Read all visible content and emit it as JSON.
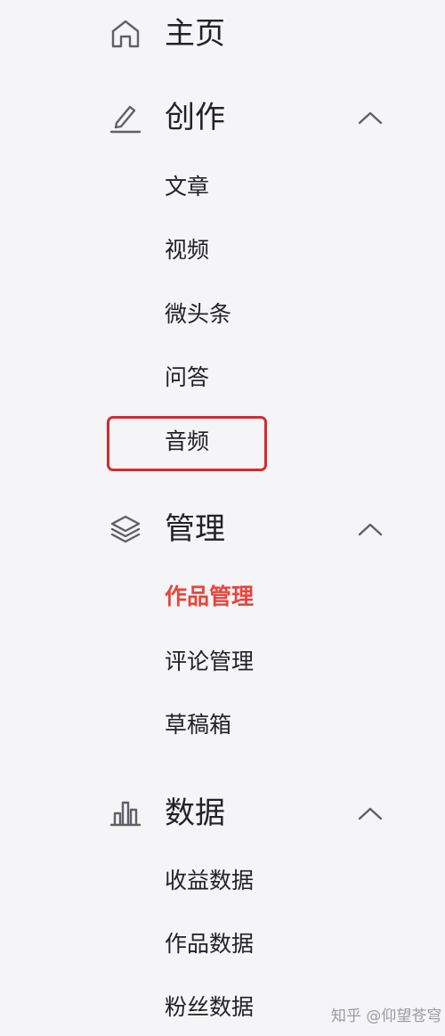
{
  "nav": {
    "home": {
      "label": "主页",
      "icon": "home-icon"
    },
    "create": {
      "label": "创作",
      "icon": "pen-icon",
      "expanded": true,
      "items": [
        {
          "label": "文章"
        },
        {
          "label": "视频"
        },
        {
          "label": "微头条"
        },
        {
          "label": "问答"
        },
        {
          "label": "音频",
          "highlighted": true
        }
      ]
    },
    "manage": {
      "label": "管理",
      "icon": "layers-icon",
      "expanded": true,
      "items": [
        {
          "label": "作品管理",
          "active": true
        },
        {
          "label": "评论管理"
        },
        {
          "label": "草稿箱"
        }
      ]
    },
    "data": {
      "label": "数据",
      "icon": "bar-chart-icon",
      "expanded": true,
      "items": [
        {
          "label": "收益数据"
        },
        {
          "label": "作品数据"
        },
        {
          "label": "粉丝数据"
        }
      ]
    }
  },
  "colors": {
    "background": "#f5f5f7",
    "text": "#222226",
    "icon": "#5f6068",
    "active": "#e8453c",
    "highlight_border": "#d9292e"
  },
  "watermark": "知乎 @仰望苍穹"
}
